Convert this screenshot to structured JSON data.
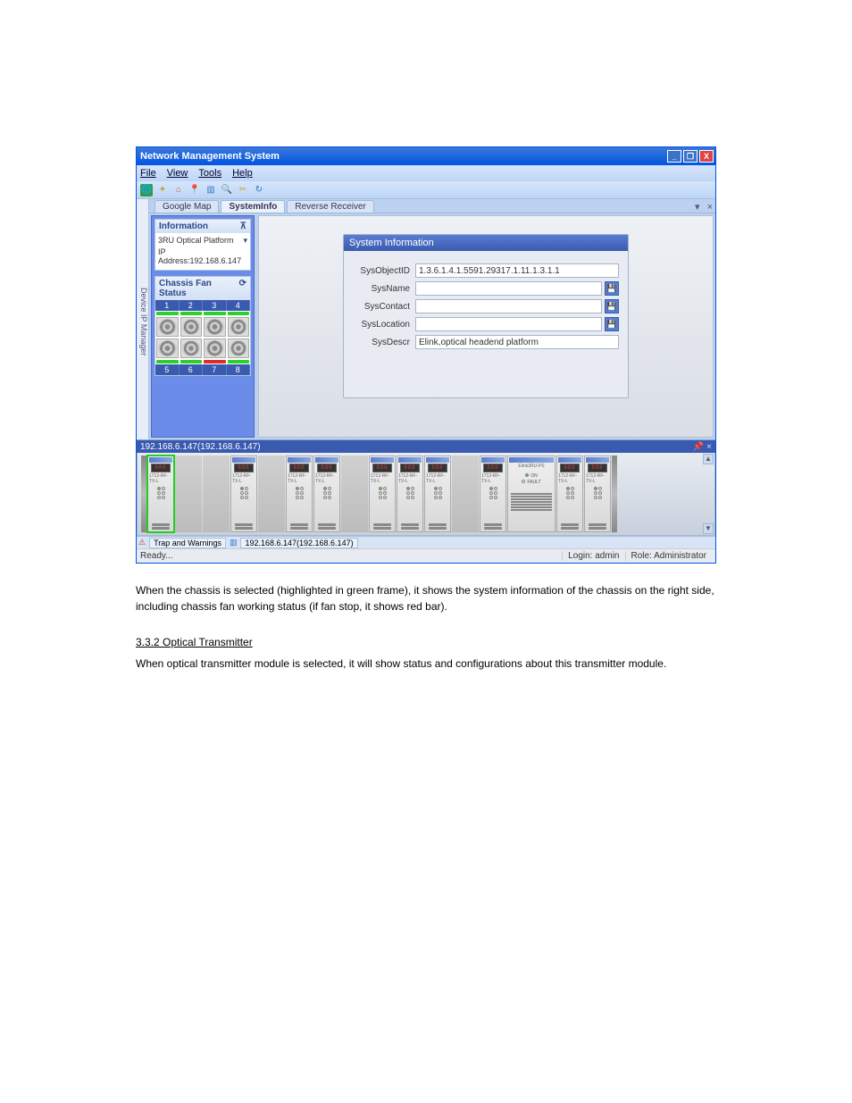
{
  "window": {
    "title": "Network Management System",
    "minimize": "_",
    "maximize": "❐",
    "close": "X"
  },
  "menu": {
    "file": "File",
    "view": "View",
    "tools": "Tools",
    "help": "Help"
  },
  "tabs": {
    "google_map": "Google Map",
    "system_info": "SystemInfo",
    "reverse_receiver": "Reverse Receiver",
    "dropdown": "▾",
    "close_x": "×"
  },
  "side_tab_label": "Device IP Manager",
  "info_panel": {
    "title": "Information",
    "collapse": "⊼",
    "rows": {
      "device": "3RU Optical Platform",
      "ip": "IP Address:192.168.6.147"
    },
    "dd": "▾"
  },
  "fan_panel": {
    "title": "Chassis Fan Status",
    "refresh": "⟳",
    "top_nums": [
      "1",
      "2",
      "3",
      "4"
    ],
    "bottom_nums": [
      "5",
      "6",
      "7",
      "8"
    ],
    "led_top": [
      "g",
      "g",
      "g",
      "g"
    ],
    "led_bottom": [
      "g",
      "g",
      "r",
      "g"
    ]
  },
  "sysinfo": {
    "title": "System Information",
    "rows": {
      "sys_object_id": {
        "label": "SysObjectID",
        "value": "1.3.6.1.4.1.5591.29317.1.11.1.3.1.1"
      },
      "sys_name": {
        "label": "SysName",
        "value": ""
      },
      "sys_contact": {
        "label": "SysContact",
        "value": ""
      },
      "sys_location": {
        "label": "SysLocation",
        "value": ""
      },
      "sys_descr": {
        "label": "SysDescr",
        "value": "Elink,optical headend platform"
      }
    },
    "save_icon": "💾"
  },
  "chassis": {
    "title": "192.168.6.147(192.168.6.147)",
    "pin": "📌",
    "close": "×",
    "module_disp": "888",
    "module_label": "1712-RF-TX-L",
    "wide_label": "Elink3RU-PS",
    "scroll_up": "▲",
    "scroll_down": "▼"
  },
  "bottom_tabs": {
    "trap": "Trap and Warnings",
    "device": "192.168.6.147(192.168.6.147)"
  },
  "statusbar": {
    "ready": "Ready...",
    "login_label": "Login:",
    "login_value": "admin",
    "role_label": "Role:",
    "role_value": "Administrator"
  },
  "doc": {
    "p1": "When the chassis is selected (highlighted in green frame), it shows the system information of the chassis on the right side, including chassis fan working status (if fan stop, it shows red bar).",
    "h": "3.3.2 Optical Transmitter",
    "p2": "When optical transmitter module is selected, it will show status and configurations about this transmitter module."
  }
}
